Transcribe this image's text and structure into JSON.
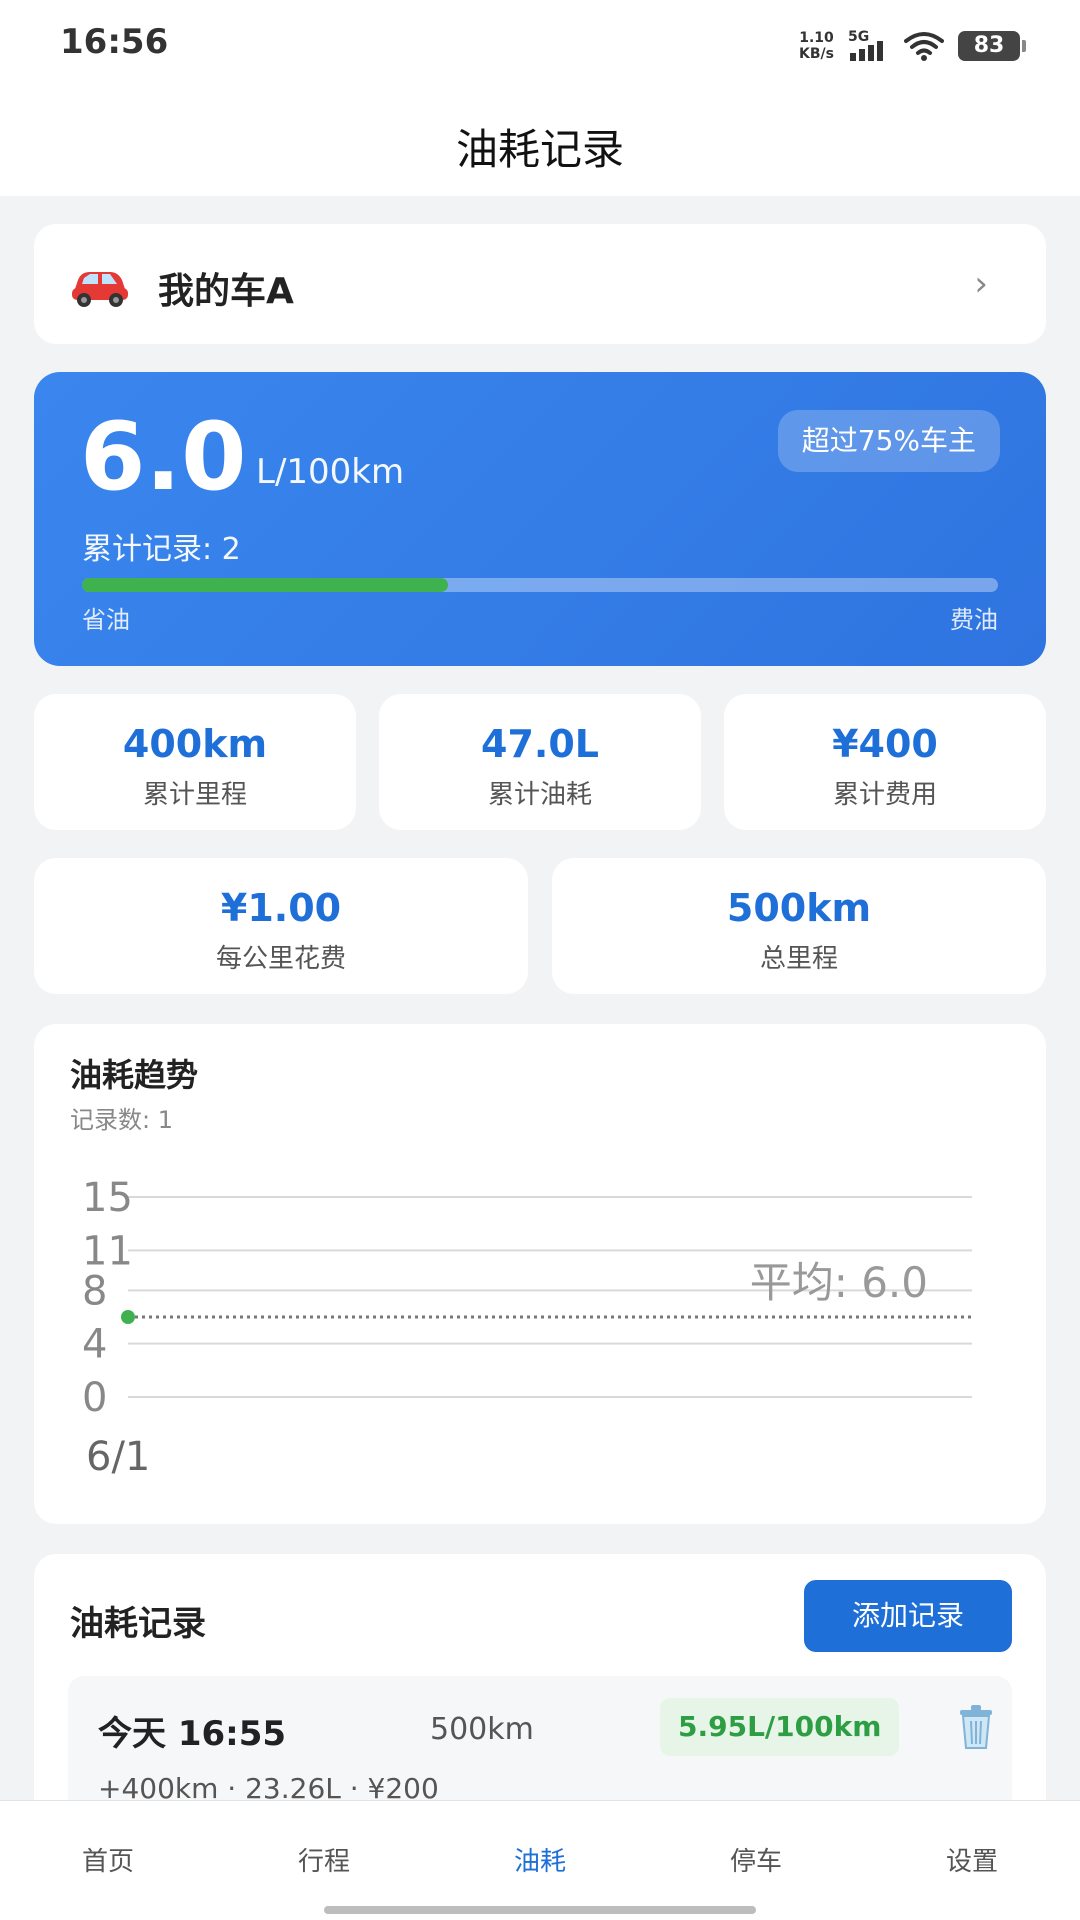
{
  "status_bar": {
    "time": "16:56",
    "net_speed_value": "1.10",
    "net_speed_unit": "KB/s",
    "network": "5G",
    "battery": "83",
    "icons": [
      "signal-icon",
      "wifi-icon",
      "battery-icon"
    ]
  },
  "header": {
    "title": "油耗记录"
  },
  "vehicle": {
    "name": "我的车A",
    "icon": "car-icon",
    "chevron": "›"
  },
  "summary": {
    "value": "6.0",
    "unit": "L/100km",
    "rank": "超过75%车主",
    "count_text": "累计记录: 2",
    "progress": 0.4,
    "scale_left": "省油",
    "scale_right": "费油",
    "progress_color": "#3fb24f",
    "accent": "#2f74e0"
  },
  "stats_row1": [
    {
      "value": "400km",
      "label": "累计里程"
    },
    {
      "value": "47.0L",
      "label": "累计油耗"
    },
    {
      "value": "¥400",
      "label": "累计费用"
    }
  ],
  "stats_row2": [
    {
      "value": "¥1.00",
      "label": "每公里花费"
    },
    {
      "value": "500km",
      "label": "总里程"
    }
  ],
  "trend": {
    "title": "油耗趋势",
    "subtitle": "记录数: 1",
    "avg_label": "平均: 6.0"
  },
  "chart_data": {
    "type": "line",
    "x": [
      "6/1"
    ],
    "series": [
      {
        "values": [
          6.0
        ]
      }
    ],
    "reference_line": {
      "value": 6.0,
      "label": "平均: 6.0"
    },
    "y_ticks": [
      0,
      4,
      8,
      11,
      15
    ],
    "ylim": [
      0,
      15
    ],
    "grid": true,
    "point_color": "#3fb24f"
  },
  "records": {
    "title": "油耗记录",
    "add_label": "添加记录",
    "items": [
      {
        "date": "今天 16:55",
        "distance": "500km",
        "consumption": "5.95L/100km",
        "detail": "+400km · 23.26L · ¥200",
        "delete_icon": "trash-icon"
      }
    ]
  },
  "nav": {
    "items": [
      "首页",
      "行程",
      "油耗",
      "停车",
      "设置"
    ],
    "active": "油耗"
  }
}
